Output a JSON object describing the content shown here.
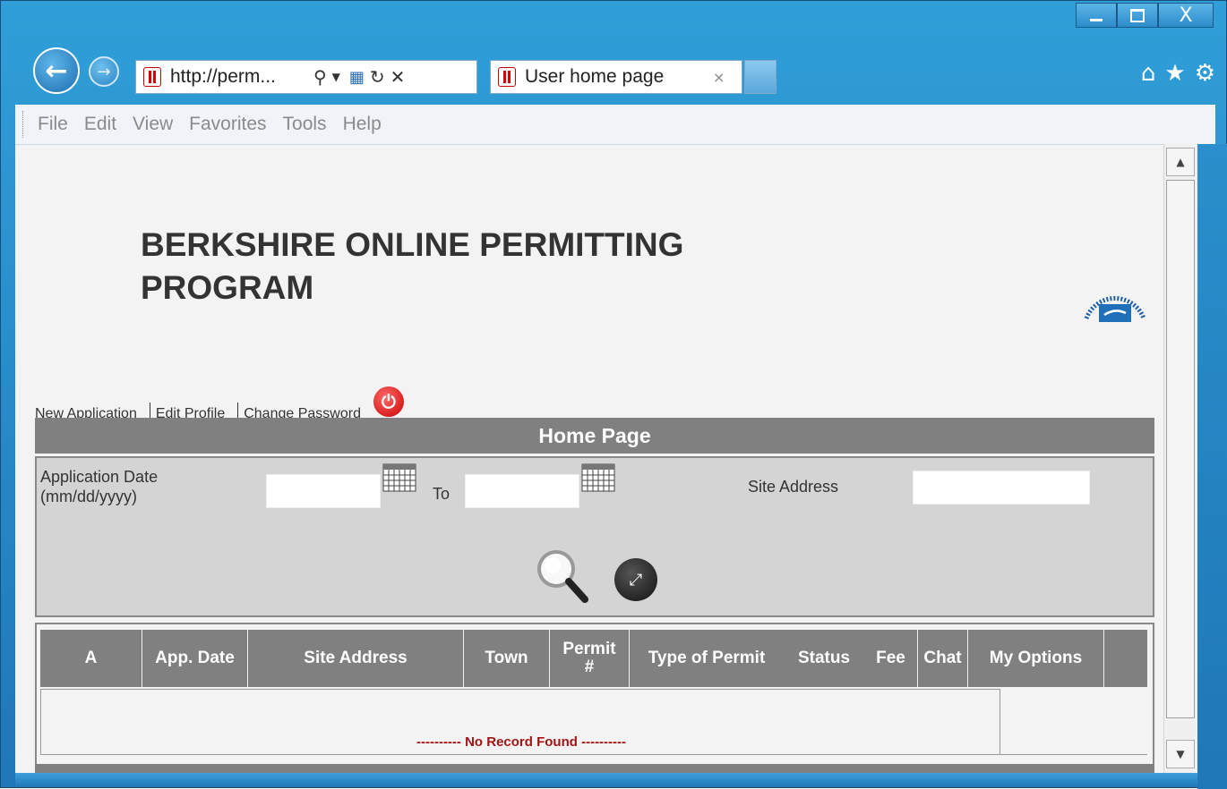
{
  "browser": {
    "controls": {
      "minimize": "—",
      "maximize": "□",
      "close": "X"
    },
    "address": {
      "url": "http://perm..."
    },
    "tab": {
      "title": "User home page",
      "close": "×"
    },
    "menu": [
      "File",
      "Edit",
      "View",
      "Favorites",
      "Tools",
      "Help"
    ],
    "icons": [
      "back-arrow-icon",
      "forward-arrow-icon",
      "search-icon",
      "dropdown-icon",
      "compat-icon",
      "refresh-icon",
      "stop-icon",
      "home-icon",
      "favorites-star-icon",
      "settings-gear-icon"
    ]
  },
  "page": {
    "title_line1": "BERKSHIRE ONLINE PERMITTING",
    "title_line2": "PROGRAM",
    "logo_text": "FULL CIRCLE TECHNOLOGIES INC",
    "links": {
      "new_application": "New Application",
      "edit_profile": "Edit Profile",
      "change_password": "Change Password"
    },
    "section_header": "Home Page",
    "search": {
      "app_date_label_1": "Application Date",
      "app_date_label_2": "(mm/dd/yyyy)",
      "to_label": "To",
      "site_address_label": "Site Address",
      "from_value": "",
      "to_value": "",
      "site_value": ""
    },
    "table": {
      "columns": [
        "A",
        "App. Date",
        "Site Address",
        "Town",
        "Permit #",
        "Type of Permit",
        "Status",
        "Fee",
        "Chat",
        "My Options"
      ],
      "empty_message": "---------- No Record Found ----------"
    }
  },
  "colors": {
    "header_gray": "#808080",
    "panel_gray": "#d4d4d4",
    "no_record_red": "#a31515",
    "power_red": "#c80000"
  }
}
